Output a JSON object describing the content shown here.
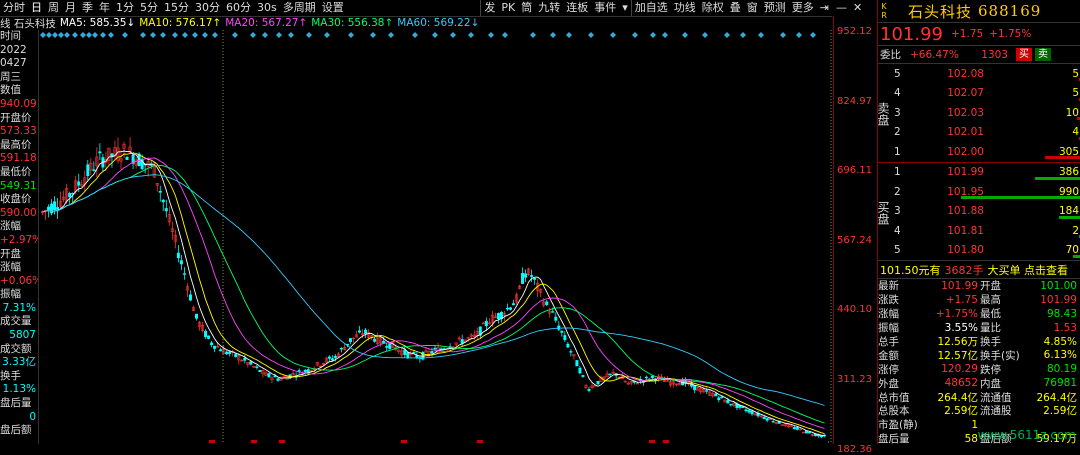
{
  "toolbar": {
    "items": [
      "分时",
      "日",
      "周",
      "月",
      "季",
      "年",
      "1分",
      "5分",
      "15分",
      "30分",
      "60分",
      "30s",
      "多周期",
      "设置"
    ],
    "right_items": [
      "发",
      "PK",
      "筒",
      "九转",
      "连板",
      "事件"
    ],
    "right_items2": [
      "加自选",
      "功线",
      "除权",
      "叠",
      "窗",
      "预测",
      "更多"
    ]
  },
  "ma": {
    "label": "线 石头科技",
    "ma5": "MA5: 585.35↓",
    "ma10": "MA10: 576.17↑",
    "ma20": "MA20: 567.27↑",
    "ma30": "MA30: 556.38↑",
    "ma60": "MA60: 569.22↓"
  },
  "colors": {
    "ma5": "#ffffff",
    "ma10": "#ffff00",
    "ma20": "#ff44ff",
    "ma30": "#00ff66",
    "ma60": "#33ccff",
    "up": "#ff3333",
    "down": "#00ffff"
  },
  "left_panel": [
    {
      "t": "时间",
      "c": "lbl"
    },
    {
      "t": "2022",
      "c": "lbl"
    },
    {
      "t": "0427",
      "c": "lbl"
    },
    {
      "t": "周三",
      "c": "lbl"
    },
    {
      "t": "数值",
      "c": "lbl"
    },
    {
      "t": "940.09",
      "c": "val red"
    },
    {
      "t": "开盘价",
      "c": "lbl"
    },
    {
      "t": "573.33",
      "c": "val red"
    },
    {
      "t": "最高价",
      "c": "lbl"
    },
    {
      "t": "591.18",
      "c": "val red"
    },
    {
      "t": "最低价",
      "c": "lbl"
    },
    {
      "t": "549.31",
      "c": "val green"
    },
    {
      "t": "收盘价",
      "c": "lbl"
    },
    {
      "t": "590.00",
      "c": "val red"
    },
    {
      "t": "涨幅",
      "c": "lbl"
    },
    {
      "t": "+2.97%",
      "c": "val red"
    },
    {
      "t": "开盘",
      "c": "lbl"
    },
    {
      "t": "涨幅",
      "c": "lbl"
    },
    {
      "t": "+0.06%",
      "c": "val red"
    },
    {
      "t": "振幅",
      "c": "lbl"
    },
    {
      "t": "7.31%",
      "c": "val cyan"
    },
    {
      "t": "成交量",
      "c": "lbl"
    },
    {
      "t": "5807",
      "c": "val cyan"
    },
    {
      "t": "成交额",
      "c": "lbl"
    },
    {
      "t": "3.33亿",
      "c": "val cyan"
    },
    {
      "t": "换手",
      "c": "lbl"
    },
    {
      "t": "1.13%",
      "c": "val cyan"
    },
    {
      "t": "盘后量",
      "c": "lbl"
    },
    {
      "t": "0",
      "c": "val cyan"
    },
    {
      "t": "盘后额",
      "c": "lbl"
    }
  ],
  "y_axis": [
    "952.12",
    "824.97",
    "696.11",
    "567.24",
    "440.10",
    "311.23",
    "182.36"
  ],
  "low_label": "98.43",
  "stock": {
    "kr": "K R",
    "name": "石头科技",
    "code": "688169",
    "price": "101.99",
    "change": "+1.75",
    "change_pct": "+1.75%"
  },
  "weibi": {
    "label": "委比",
    "value": "+66.47%",
    "diff": "1303",
    "buy": "买",
    "sell": "卖"
  },
  "asks": [
    {
      "i": "5",
      "p": "102.08",
      "v": "5",
      "w": 0.02
    },
    {
      "i": "4",
      "p": "102.07",
      "v": "5",
      "w": 0.02
    },
    {
      "i": "3",
      "p": "102.03",
      "v": "10",
      "w": 0.03
    },
    {
      "i": "2",
      "p": "102.01",
      "v": "4",
      "w": 0.02
    },
    {
      "i": "1",
      "p": "102.00",
      "v": "305",
      "w": 0.3
    }
  ],
  "bids": [
    {
      "i": "1",
      "p": "101.99",
      "v": "386",
      "w": 0.38
    },
    {
      "i": "2",
      "p": "101.95",
      "v": "990",
      "w": 1.0
    },
    {
      "i": "3",
      "p": "101.88",
      "v": "184",
      "w": 0.18
    },
    {
      "i": "4",
      "p": "101.81",
      "v": "2",
      "w": 0.01
    },
    {
      "i": "5",
      "p": "101.80",
      "v": "70",
      "w": 0.07
    }
  ],
  "ask_side": "卖盘",
  "bid_side": "买盘",
  "trade": {
    "price": "101.50元有",
    "vol": "3682手",
    "tip": "大买单 点击查看"
  },
  "quotes": [
    {
      "k": "最新",
      "v": "101.99",
      "vc": "red",
      "k2": "开盘",
      "v2": "101.00",
      "v2c": "green"
    },
    {
      "k": "涨跌",
      "v": "+1.75",
      "vc": "red",
      "k2": "最高",
      "v2": "101.99",
      "v2c": "red"
    },
    {
      "k": "涨幅",
      "v": "+1.75%",
      "vc": "red",
      "k2": "最低",
      "v2": "98.43",
      "v2c": "green"
    },
    {
      "k": "振幅",
      "v": "3.55%",
      "vc": "white",
      "k2": "量比",
      "v2": "1.53",
      "v2c": "red"
    },
    {
      "k": "总手",
      "v": "12.56万",
      "vc": "yellow",
      "k2": "换手",
      "v2": "4.85%",
      "v2c": "yellow"
    },
    {
      "k": "金额",
      "v": "12.57亿",
      "vc": "yellow",
      "k2": "换手(实)",
      "v2": "6.13%",
      "v2c": "yellow"
    },
    {
      "k": "涨停",
      "v": "120.29",
      "vc": "red",
      "k2": "跌停",
      "v2": "80.19",
      "v2c": "green"
    },
    {
      "k": "外盘",
      "v": "48652",
      "vc": "red",
      "k2": "内盘",
      "v2": "76981",
      "v2c": "green"
    },
    {
      "k": "总市值",
      "v": "264.4亿",
      "vc": "yellow",
      "k2": "流通值",
      "v2": "264.4亿",
      "v2c": "yellow"
    },
    {
      "k": "总股本",
      "v": "2.59亿",
      "vc": "yellow",
      "k2": "流通股",
      "v2": "2.59亿",
      "v2c": "yellow"
    },
    {
      "k": "市盈(静)",
      "v": "1",
      "vc": "yellow",
      "k2": "",
      "v2": "",
      "v2c": "yellow"
    },
    {
      "k": "盘后量",
      "v": "58",
      "vc": "yellow",
      "k2": "盘后额",
      "v2": "59.17万",
      "v2c": "yellow"
    }
  ],
  "watermark": "www.5611z.com",
  "chart_data": {
    "type": "candlestick",
    "y_range": [
      98.43,
      952.12
    ],
    "ma_names": [
      "MA5",
      "MA10",
      "MA20",
      "MA30",
      "MA60"
    ],
    "close_path": [
      [
        0,
        570
      ],
      [
        4,
        610
      ],
      [
        8,
        680
      ],
      [
        12,
        700
      ],
      [
        16,
        660
      ],
      [
        18,
        560
      ],
      [
        20,
        460
      ],
      [
        22,
        350
      ],
      [
        24,
        300
      ],
      [
        26,
        280
      ],
      [
        28,
        268
      ],
      [
        30,
        250
      ],
      [
        32,
        230
      ],
      [
        34,
        222
      ],
      [
        36,
        232
      ],
      [
        38,
        240
      ],
      [
        40,
        256
      ],
      [
        42,
        268
      ],
      [
        44,
        302
      ],
      [
        46,
        320
      ],
      [
        48,
        304
      ],
      [
        50,
        292
      ],
      [
        52,
        275
      ],
      [
        54,
        268
      ],
      [
        56,
        280
      ],
      [
        58,
        290
      ],
      [
        60,
        302
      ],
      [
        62,
        310
      ],
      [
        64,
        345
      ],
      [
        66,
        360
      ],
      [
        68,
        390
      ],
      [
        69,
        445
      ],
      [
        70,
        440
      ],
      [
        71,
        410
      ],
      [
        72,
        380
      ],
      [
        73,
        360
      ],
      [
        74,
        330
      ],
      [
        75,
        300
      ],
      [
        76,
        270
      ],
      [
        77,
        240
      ],
      [
        78,
        200
      ],
      [
        80,
        220
      ],
      [
        82,
        235
      ],
      [
        84,
        210
      ],
      [
        86,
        220
      ],
      [
        88,
        225
      ],
      [
        90,
        215
      ],
      [
        92,
        215
      ],
      [
        94,
        200
      ],
      [
        96,
        190
      ],
      [
        98,
        175
      ],
      [
        100,
        162
      ],
      [
        102,
        150
      ],
      [
        104,
        138
      ],
      [
        106,
        128
      ],
      [
        108,
        118
      ],
      [
        110,
        108
      ],
      [
        112,
        102
      ]
    ],
    "low_marker": 98.43
  }
}
